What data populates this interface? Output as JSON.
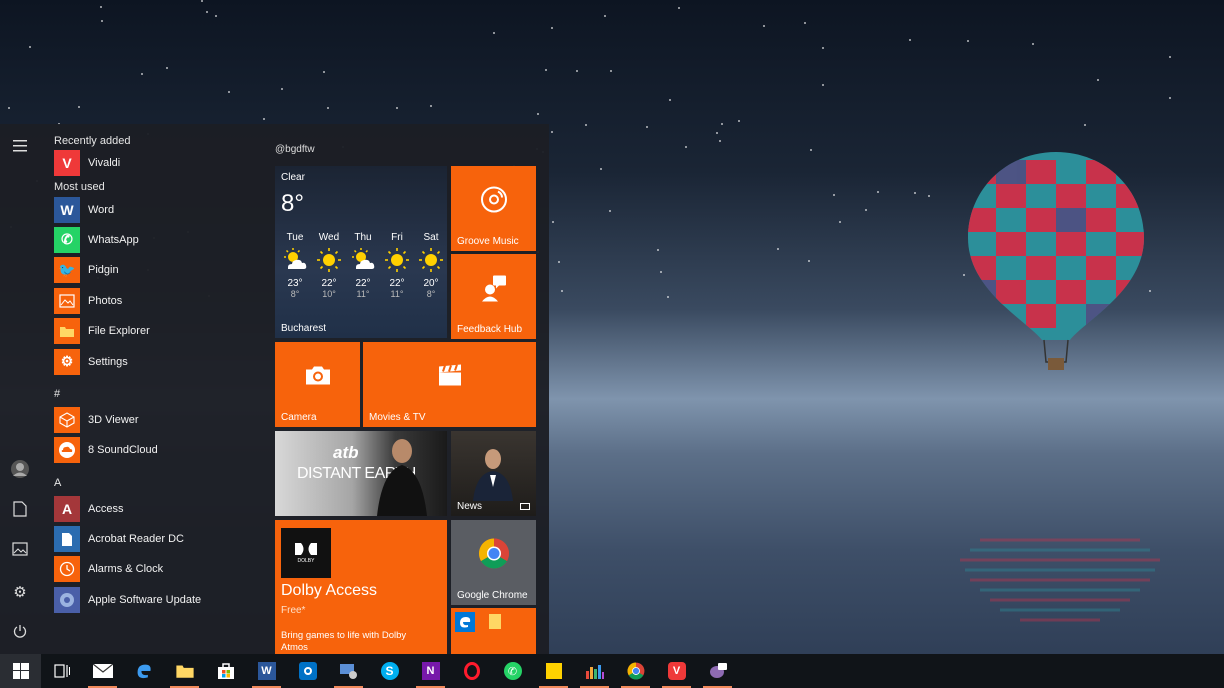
{
  "start_menu": {
    "sections": {
      "recently_added": "Recently added",
      "most_used": "Most used",
      "hash": "#",
      "a": "A"
    },
    "recent": [
      {
        "label": "Vivaldi"
      }
    ],
    "most_used": [
      {
        "label": "Word"
      },
      {
        "label": "WhatsApp"
      },
      {
        "label": "Pidgin"
      },
      {
        "label": "Photos"
      },
      {
        "label": "File Explorer"
      },
      {
        "label": "Settings"
      }
    ],
    "hash_apps": [
      {
        "label": "3D Viewer"
      },
      {
        "label": "8 SoundCloud"
      }
    ],
    "a_apps": [
      {
        "label": "Access"
      },
      {
        "label": "Acrobat Reader DC"
      },
      {
        "label": "Alarms & Clock"
      },
      {
        "label": "Apple Software Update"
      }
    ],
    "group_title": "@bgdftw",
    "tiles": {
      "weather": {
        "condition": "Clear",
        "temp": "8°",
        "city": "Bucharest",
        "days": [
          {
            "day": "Tue",
            "hi": "23°",
            "lo": "8°",
            "icon": "partly-cloudy-icon"
          },
          {
            "day": "Wed",
            "hi": "22°",
            "lo": "10°",
            "icon": "sun-icon"
          },
          {
            "day": "Thu",
            "hi": "22°",
            "lo": "11°",
            "icon": "partly-cloudy-icon"
          },
          {
            "day": "Fri",
            "hi": "22°",
            "lo": "11°",
            "icon": "sun-icon"
          },
          {
            "day": "Sat",
            "hi": "20°",
            "lo": "8°",
            "icon": "sun-icon"
          }
        ]
      },
      "groove": "Groove Music",
      "feedback": "Feedback Hub",
      "camera": "Camera",
      "movies": "Movies & TV",
      "news": "News",
      "chrome": "Google Chrome",
      "dolby": {
        "name": "Dolby Access",
        "price": "Free*",
        "desc": "Bring games to life with Dolby Atmos",
        "logo_text": "DOLBY"
      },
      "album": {
        "artist": "atb",
        "title": "DISTANT EARTH"
      }
    }
  },
  "colors": {
    "accent": "#f7630c",
    "taskbar": "#101418"
  }
}
